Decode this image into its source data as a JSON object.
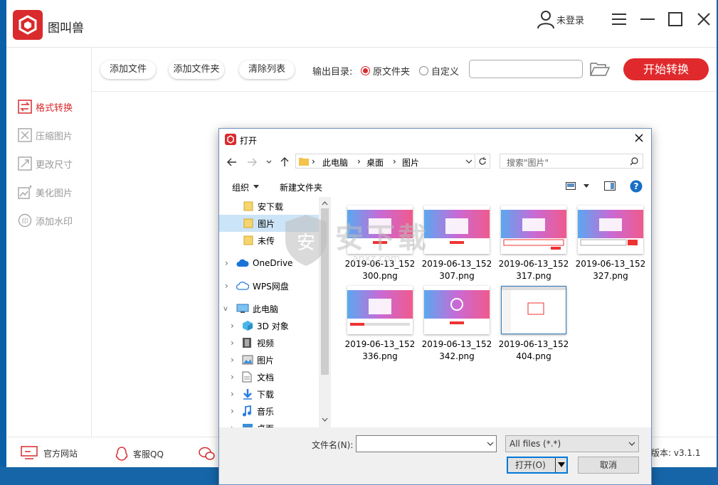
{
  "app": {
    "title": "图叫兽",
    "user_label": "未登录",
    "brand_color": "#d92a2e"
  },
  "toolbar": {
    "add_file": "添加文件",
    "add_folder": "添加文件夹",
    "clear_list": "清除列表",
    "output_label": "输出目录:",
    "radio_original": "原文件夹",
    "radio_custom": "自定义",
    "output_path": "",
    "start": "开始转换"
  },
  "sidebar": {
    "items": [
      {
        "label": "格式转换",
        "icon": "convert-icon",
        "active": true
      },
      {
        "label": "压缩图片",
        "icon": "compress-icon",
        "active": false
      },
      {
        "label": "更改尺寸",
        "icon": "resize-icon",
        "active": false
      },
      {
        "label": "美化图片",
        "icon": "beautify-icon",
        "active": false
      },
      {
        "label": "添加水印",
        "icon": "watermark-icon",
        "active": false
      }
    ]
  },
  "footer": {
    "website": "官方网站",
    "qq": "客服QQ",
    "version": "版本: v3.1.1"
  },
  "dialog": {
    "title": "打开",
    "breadcrumb": [
      "此电脑",
      "桌面",
      "图片"
    ],
    "search_placeholder": "搜索\"图片\"",
    "organize": "组织",
    "new_folder": "新建文件夹",
    "tree": [
      {
        "label": "安下载",
        "icon": "folder-icon"
      },
      {
        "label": "图片",
        "icon": "folder-icon",
        "selected": true
      },
      {
        "label": "未传",
        "icon": "folder-icon"
      },
      {
        "label": "OneDrive",
        "icon": "cloud-icon"
      },
      {
        "label": "WPS网盘",
        "icon": "cloud-outline-icon"
      },
      {
        "label": "此电脑",
        "icon": "computer-icon"
      },
      {
        "label": "3D 对象",
        "icon": "cube-icon"
      },
      {
        "label": "视频",
        "icon": "film-icon"
      },
      {
        "label": "图片",
        "icon": "pictures-icon"
      },
      {
        "label": "文档",
        "icon": "document-icon"
      },
      {
        "label": "下载",
        "icon": "download-icon"
      },
      {
        "label": "音乐",
        "icon": "music-icon"
      },
      {
        "label": "桌面",
        "icon": "desktop-icon"
      }
    ],
    "files": [
      {
        "line1": "2019-06-13_152",
        "line2": "300.png"
      },
      {
        "line1": "2019-06-13_152",
        "line2": "307.png"
      },
      {
        "line1": "2019-06-13_152",
        "line2": "317.png"
      },
      {
        "line1": "2019-06-13_152",
        "line2": "327.png"
      },
      {
        "line1": "2019-06-13_152",
        "line2": "336.png"
      },
      {
        "line1": "2019-06-13_152",
        "line2": "342.png"
      },
      {
        "line1": "2019-06-13_152",
        "line2": "404.png"
      }
    ],
    "filename_label": "文件名(N):",
    "filename_value": "",
    "filter": "All files (*.*)",
    "open": "打开(O)",
    "cancel": "取消"
  },
  "watermark": {
    "text": "安下载",
    "sub": "anxz.com"
  }
}
